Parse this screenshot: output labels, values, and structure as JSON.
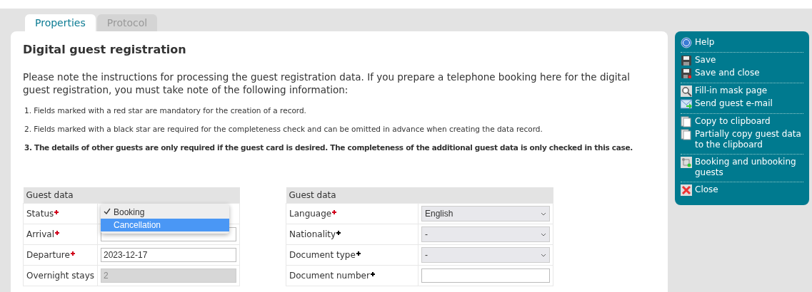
{
  "tabs": [
    {
      "label": "Properties",
      "selected": true
    },
    {
      "label": "Protocol",
      "selected": false
    }
  ],
  "title": "Digital guest registration",
  "intro": "Please note the instructions for processing the guest registration data. If you prepare a telephone booking here for the digital guest registration, you must take note of the following information:",
  "notes": [
    {
      "text": "1. Fields marked with a red star are mandatory for the creation of a record.",
      "bold": false
    },
    {
      "text": "2. Fields marked with a black star are required for the completeness check and can be omitted in advance when creating the data record.",
      "bold": false
    },
    {
      "text": "3. The details of other guests are only required if the guest card is desired. The completeness of the additional guest data is only checked in this case.",
      "bold": true
    }
  ],
  "tables": [
    {
      "header": "Guest data",
      "rows": [
        {
          "label": "Status",
          "star": true,
          "color": "#d0021b",
          "kind": "dropdown_open",
          "options": [
            {
              "label": "Booking",
              "checked": true,
              "selected": false
            },
            {
              "label": "Cancellation",
              "checked": false,
              "selected": true
            }
          ]
        },
        {
          "label": "Arrival",
          "star": true,
          "color": "#d0021b",
          "kind": "text"
        },
        {
          "label": "Departure",
          "star": true,
          "color": "#d0021b",
          "kind": "text",
          "value": "2023-12-17"
        },
        {
          "label": "Overnight stays",
          "kind": "readonly",
          "value": "2"
        }
      ]
    },
    {
      "header": "Guest data",
      "rows": [
        {
          "label": "Language",
          "star": true,
          "color": "#d0021b",
          "kind": "select",
          "value": "English"
        },
        {
          "label": "Nationality",
          "star": true,
          "color": "#000000",
          "kind": "select",
          "value": "-"
        },
        {
          "label": "Document type",
          "star": true,
          "color": "#000000",
          "kind": "select",
          "value": "-"
        },
        {
          "label": "Document number",
          "star": true,
          "color": "#000000",
          "kind": "text"
        }
      ]
    }
  ],
  "actions": [
    [
      {
        "label": "Help"
      }
    ],
    [
      {
        "label": "Save"
      },
      {
        "label": "Save and close"
      }
    ],
    [
      {
        "label": "Fill-in mask page"
      },
      {
        "label": "Send guest e-mail"
      }
    ],
    [
      {
        "label": "Copy to clipboard"
      },
      {
        "label": "Partially copy guest data to the clipboard"
      }
    ],
    [
      {
        "label": "Booking and unbooking guests"
      }
    ],
    [
      {
        "label": "Close"
      }
    ]
  ]
}
